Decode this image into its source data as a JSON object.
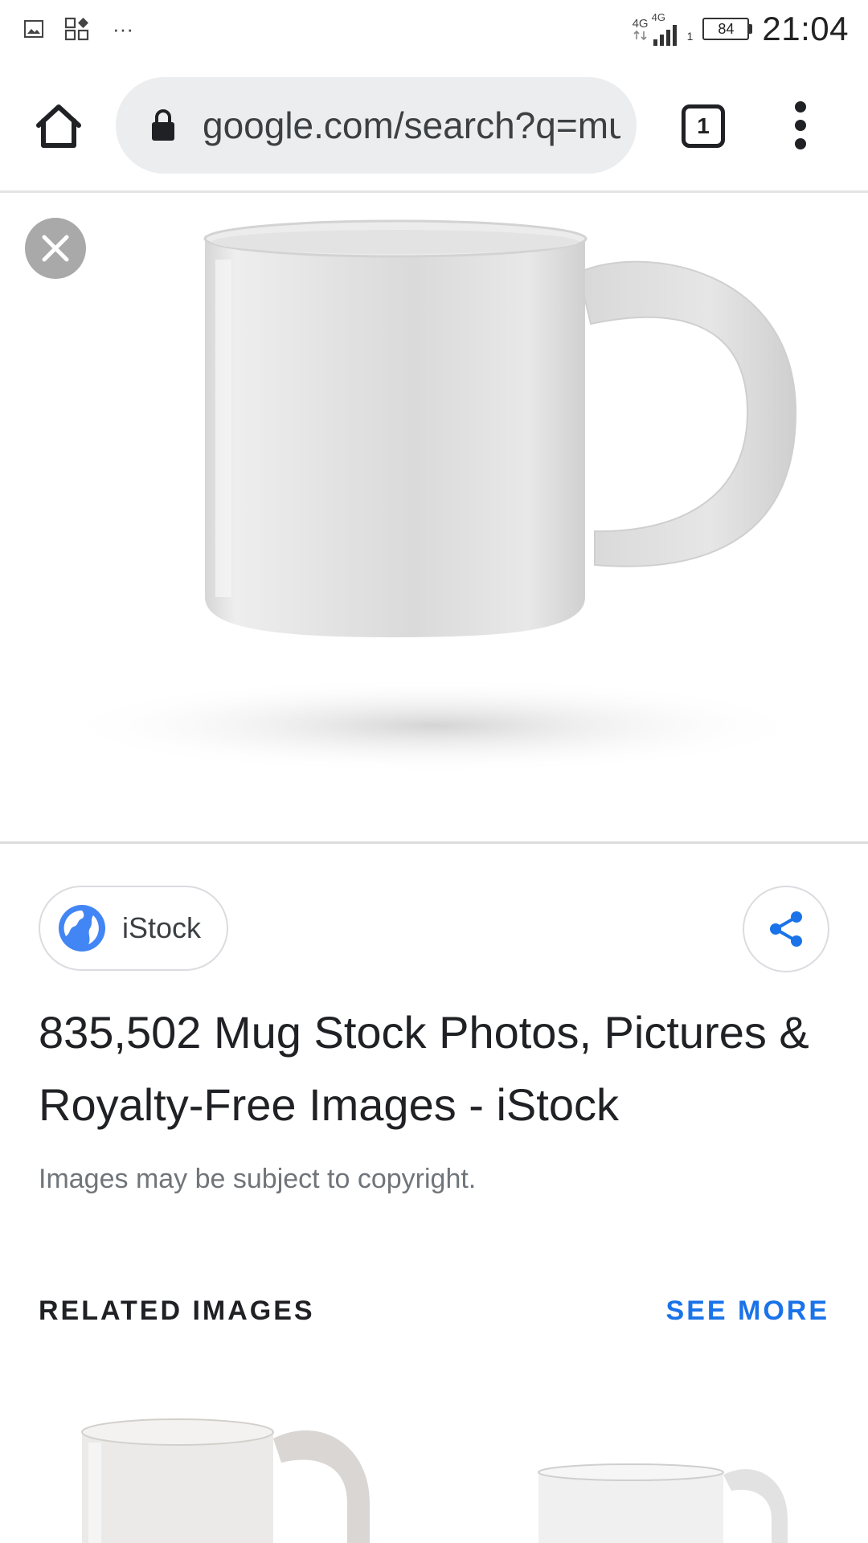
{
  "status_bar": {
    "network_label_1": "4G",
    "network_label_2": "4G",
    "sim_slot": "1",
    "battery": "84",
    "time": "21:04",
    "overflow": "···",
    "icons": [
      "gallery-notification-icon",
      "app-grid-icon",
      "signal-icon",
      "battery-icon"
    ]
  },
  "toolbar": {
    "url": "google.com/search?q=mug",
    "tab_count": "1",
    "icons": [
      "home-icon",
      "lock-icon",
      "tabs-icon",
      "more-vert-icon"
    ]
  },
  "viewer": {
    "close_icon": "close-icon",
    "image_subject": "mug"
  },
  "details": {
    "source_name": "iStock",
    "source_icon": "globe-icon",
    "share_icon": "share-icon",
    "title": "835,502 Mug Stock Photos, Pictures & Royalty-Free Images - iStock",
    "copyright_note": "Images may be subject to copyright."
  },
  "related": {
    "header": "RELATED IMAGES",
    "see_more": "SEE MORE"
  },
  "colors": {
    "accent": "#1a73e8",
    "url_bar_bg": "#ebedef",
    "text_primary": "#202124",
    "text_secondary": "#70757a"
  }
}
